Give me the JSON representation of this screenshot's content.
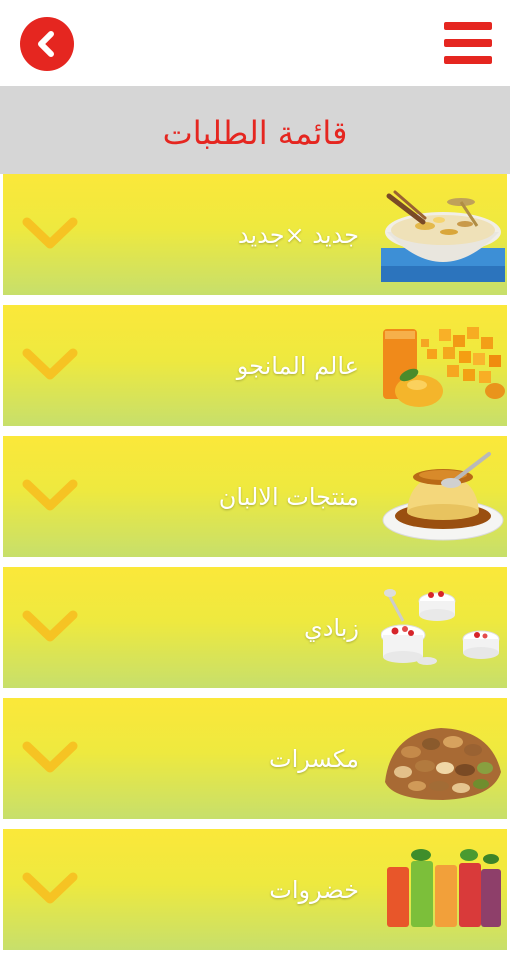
{
  "header": {
    "back_icon": "chevron-left-icon",
    "menu_icon": "hamburger-menu-icon",
    "accent_color": "#e52620"
  },
  "page": {
    "title": "قائمة الطلبات"
  },
  "categories": [
    {
      "label": "جديد ×جديد",
      "image": "pudding-bowl-image",
      "expand_icon": "chevron-down-icon"
    },
    {
      "label": "عالم المانجو",
      "image": "mango-juice-image",
      "expand_icon": "chevron-down-icon"
    },
    {
      "label": "منتجات الالبان",
      "image": "creme-caramel-image",
      "expand_icon": "chevron-down-icon"
    },
    {
      "label": "زبادي",
      "image": "yogurt-cups-image",
      "expand_icon": "chevron-down-icon"
    },
    {
      "label": "مكسرات",
      "image": "mixed-nuts-image",
      "expand_icon": "chevron-down-icon"
    },
    {
      "label": "خضروات",
      "image": "vegetable-juices-image",
      "expand_icon": "chevron-down-icon"
    }
  ]
}
